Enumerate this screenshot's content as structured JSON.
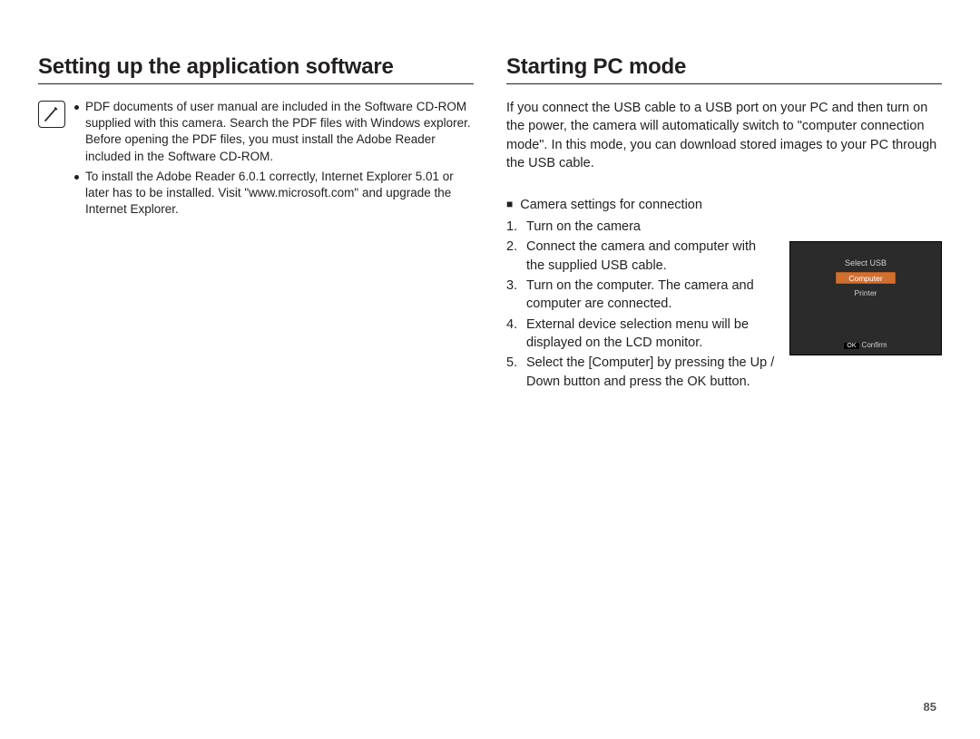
{
  "left": {
    "heading": "Setting up the application software",
    "notes": [
      "PDF documents of user manual are included in the Software CD-ROM supplied with this camera. Search the PDF files with Windows explorer.\nBefore opening the PDF files, you must install the Adobe Reader included in the Software CD-ROM.",
      "To install the Adobe Reader 6.0.1 correctly, Internet Explorer 5.01 or later has to be installed. Visit \"www.microsoft.com\" and upgrade the Internet Explorer."
    ]
  },
  "right": {
    "heading": "Starting PC mode",
    "intro": "If you connect the USB cable to a USB port on your PC and then turn on the power, the camera will automatically switch to \"computer connection mode\". In this mode, you can download stored images to your PC through the USB cable.",
    "subhead": "Camera settings for connection",
    "steps": [
      "Turn on the camera",
      "Connect the camera and computer with the supplied USB cable.",
      "Turn on the computer. The camera and computer are connected.",
      "External device selection menu will be displayed on the LCD monitor.",
      "Select the [Computer] by pressing the Up / Down button and press the OK button."
    ],
    "lcd": {
      "title": "Select USB",
      "options": [
        "Computer",
        "Printer"
      ],
      "selected_index": 0,
      "ok_label": "OK",
      "confirm_label": "Confirm"
    }
  },
  "page_number": "85"
}
